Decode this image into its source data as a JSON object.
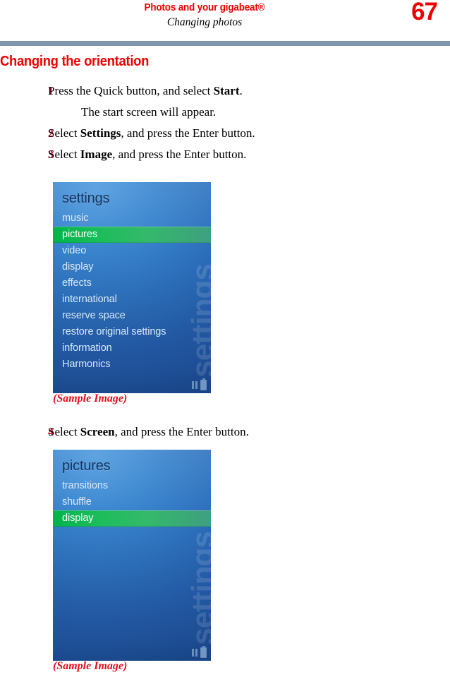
{
  "header": {
    "title": "Photos and your gigabeat®",
    "subtitle": "Changing photos",
    "page_number": "67",
    "rule_color": "#8096ae",
    "accent_color": "#ee0000"
  },
  "section": {
    "heading": "Changing the orientation"
  },
  "steps": [
    {
      "number": "1",
      "text_before": "Press the Quick button, and select ",
      "bold": "Start",
      "text_after": ".",
      "sub": "The start screen will appear."
    },
    {
      "number": "2",
      "text_before": "Select ",
      "bold": "Settings",
      "text_after": ", and press the Enter button.",
      "sub": ""
    },
    {
      "number": "3",
      "text_before": "Select ",
      "bold": "Image",
      "text_after": ", and press the Enter button.",
      "sub": ""
    },
    {
      "number": "4",
      "text_before": "Select ",
      "bold": "Screen",
      "text_after": ", and press the Enter button.",
      "sub": ""
    }
  ],
  "screenshot_1": {
    "title": "settings",
    "watermark": "settings",
    "selected_item": "pictures",
    "items": [
      "music",
      "pictures",
      "video",
      "display",
      "effects",
      "international",
      "reserve space",
      "restore original settings",
      "information",
      "Harmonics"
    ],
    "status_icons": [
      "pause-icon",
      "battery-icon"
    ],
    "caption": "(Sample Image)",
    "highlight_color": "#1dbd5c",
    "background_color": "#2f73bf"
  },
  "screenshot_2": {
    "title": "pictures",
    "watermark": "settings",
    "selected_item": "display",
    "items": [
      "transitions",
      "shuffle",
      "display"
    ],
    "status_icons": [
      "pause-icon",
      "battery-icon"
    ],
    "caption": "(Sample Image)",
    "highlight_color": "#1dbd5c",
    "background_color": "#2f73bf"
  }
}
